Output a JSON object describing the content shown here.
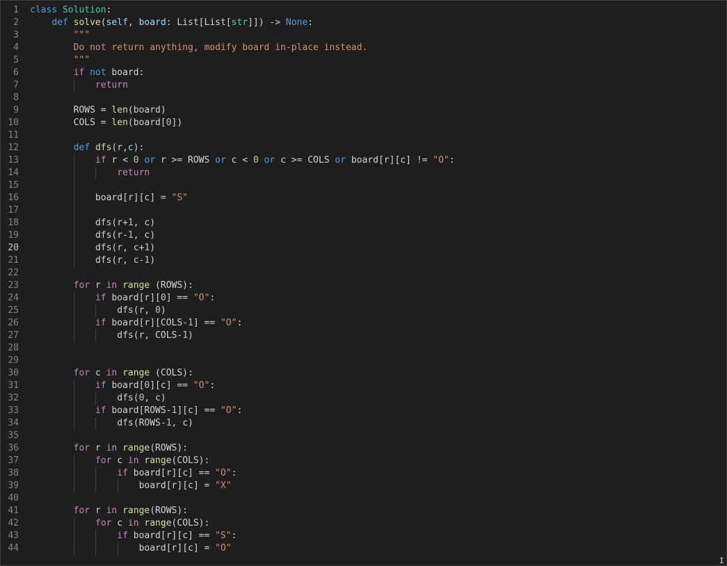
{
  "editor": {
    "cursor_glyph": "I",
    "active_line": 20,
    "lines": [
      {
        "n": "1",
        "indent": 0,
        "t": [
          [
            "kw",
            "class "
          ],
          [
            "cls",
            "Solution"
          ],
          [
            "plain",
            ":"
          ]
        ]
      },
      {
        "n": "2",
        "indent": 1,
        "t": [
          [
            "kw",
            "def "
          ],
          [
            "fn",
            "solve"
          ],
          [
            "plain",
            "("
          ],
          [
            "param",
            "self"
          ],
          [
            "plain",
            ", "
          ],
          [
            "param",
            "board"
          ],
          [
            "plain",
            ": List[List["
          ],
          [
            "cls",
            "str"
          ],
          [
            "plain",
            "]]) -> "
          ],
          [
            "kw",
            "None"
          ],
          [
            "plain",
            ":"
          ]
        ]
      },
      {
        "n": "3",
        "indent": 2,
        "t": [
          [
            "str",
            "\"\"\""
          ]
        ]
      },
      {
        "n": "4",
        "indent": 2,
        "t": [
          [
            "str",
            "Do not return anything, modify board in-place instead."
          ]
        ]
      },
      {
        "n": "5",
        "indent": 2,
        "t": [
          [
            "str",
            "\"\"\""
          ]
        ]
      },
      {
        "n": "6",
        "indent": 2,
        "t": [
          [
            "ctrl",
            "if "
          ],
          [
            "kw",
            "not "
          ],
          [
            "plain",
            "board:"
          ]
        ]
      },
      {
        "n": "7",
        "indent": 3,
        "t": [
          [
            "ctrl",
            "return"
          ]
        ]
      },
      {
        "n": "8",
        "indent": 2,
        "t": []
      },
      {
        "n": "9",
        "indent": 2,
        "t": [
          [
            "plain",
            "ROWS = "
          ],
          [
            "fn",
            "len"
          ],
          [
            "plain",
            "(board)"
          ]
        ]
      },
      {
        "n": "10",
        "indent": 2,
        "t": [
          [
            "plain",
            "COLS = "
          ],
          [
            "fn",
            "len"
          ],
          [
            "plain",
            "(board["
          ],
          [
            "num",
            "0"
          ],
          [
            "plain",
            "])"
          ]
        ]
      },
      {
        "n": "11",
        "indent": 2,
        "t": []
      },
      {
        "n": "12",
        "indent": 2,
        "t": [
          [
            "kw",
            "def "
          ],
          [
            "fn",
            "dfs"
          ],
          [
            "plain",
            "("
          ],
          [
            "param",
            "r"
          ],
          [
            "plain",
            ","
          ],
          [
            "param",
            "c"
          ],
          [
            "plain",
            "):"
          ]
        ]
      },
      {
        "n": "13",
        "indent": 3,
        "t": [
          [
            "ctrl",
            "if "
          ],
          [
            "plain",
            "r < "
          ],
          [
            "num",
            "0"
          ],
          [
            "plain",
            " "
          ],
          [
            "kw",
            "or"
          ],
          [
            "plain",
            " r >= ROWS "
          ],
          [
            "kw",
            "or"
          ],
          [
            "plain",
            " c < "
          ],
          [
            "num",
            "0"
          ],
          [
            "plain",
            " "
          ],
          [
            "kw",
            "or"
          ],
          [
            "plain",
            " c >= COLS "
          ],
          [
            "kw",
            "or"
          ],
          [
            "plain",
            " board[r][c] != "
          ],
          [
            "str",
            "\"O\""
          ],
          [
            "plain",
            ":"
          ]
        ]
      },
      {
        "n": "14",
        "indent": 4,
        "t": [
          [
            "ctrl",
            "return"
          ]
        ]
      },
      {
        "n": "15",
        "indent": 3,
        "t": []
      },
      {
        "n": "16",
        "indent": 3,
        "t": [
          [
            "plain",
            "board[r][c] = "
          ],
          [
            "str",
            "\"S\""
          ]
        ]
      },
      {
        "n": "17",
        "indent": 3,
        "t": []
      },
      {
        "n": "18",
        "indent": 3,
        "t": [
          [
            "plain",
            "dfs(r+"
          ],
          [
            "num",
            "1"
          ],
          [
            "plain",
            ", c)"
          ]
        ]
      },
      {
        "n": "19",
        "indent": 3,
        "t": [
          [
            "plain",
            "dfs(r-"
          ],
          [
            "num",
            "1"
          ],
          [
            "plain",
            ", c)"
          ]
        ]
      },
      {
        "n": "20",
        "indent": 3,
        "t": [
          [
            "plain",
            "dfs(r, c+"
          ],
          [
            "num",
            "1"
          ],
          [
            "plain",
            ")"
          ]
        ]
      },
      {
        "n": "21",
        "indent": 3,
        "t": [
          [
            "plain",
            "dfs(r, c-"
          ],
          [
            "num",
            "1"
          ],
          [
            "plain",
            ")"
          ]
        ]
      },
      {
        "n": "22",
        "indent": 2,
        "t": []
      },
      {
        "n": "23",
        "indent": 2,
        "t": [
          [
            "ctrl",
            "for "
          ],
          [
            "plain",
            "r "
          ],
          [
            "ctrl",
            "in "
          ],
          [
            "fn",
            "range"
          ],
          [
            "plain",
            " (ROWS):"
          ]
        ]
      },
      {
        "n": "24",
        "indent": 3,
        "t": [
          [
            "ctrl",
            "if "
          ],
          [
            "plain",
            "board[r]["
          ],
          [
            "num",
            "0"
          ],
          [
            "plain",
            "] == "
          ],
          [
            "str",
            "\"O\""
          ],
          [
            "plain",
            ":"
          ]
        ]
      },
      {
        "n": "25",
        "indent": 4,
        "t": [
          [
            "plain",
            "dfs(r, "
          ],
          [
            "num",
            "0"
          ],
          [
            "plain",
            ")"
          ]
        ]
      },
      {
        "n": "26",
        "indent": 3,
        "t": [
          [
            "ctrl",
            "if "
          ],
          [
            "plain",
            "board[r][COLS-"
          ],
          [
            "num",
            "1"
          ],
          [
            "plain",
            "] == "
          ],
          [
            "str",
            "\"O\""
          ],
          [
            "plain",
            ":"
          ]
        ]
      },
      {
        "n": "27",
        "indent": 4,
        "t": [
          [
            "plain",
            "dfs(r, COLS-"
          ],
          [
            "num",
            "1"
          ],
          [
            "plain",
            ")"
          ]
        ]
      },
      {
        "n": "28",
        "indent": 2,
        "t": []
      },
      {
        "n": "29",
        "indent": 2,
        "t": []
      },
      {
        "n": "30",
        "indent": 2,
        "t": [
          [
            "ctrl",
            "for "
          ],
          [
            "plain",
            "c "
          ],
          [
            "ctrl",
            "in "
          ],
          [
            "fn",
            "range"
          ],
          [
            "plain",
            " (COLS):"
          ]
        ]
      },
      {
        "n": "31",
        "indent": 3,
        "t": [
          [
            "ctrl",
            "if "
          ],
          [
            "plain",
            "board["
          ],
          [
            "num",
            "0"
          ],
          [
            "plain",
            "][c] == "
          ],
          [
            "str",
            "\"O\""
          ],
          [
            "plain",
            ":"
          ]
        ]
      },
      {
        "n": "32",
        "indent": 4,
        "t": [
          [
            "plain",
            "dfs("
          ],
          [
            "num",
            "0"
          ],
          [
            "plain",
            ", c)"
          ]
        ]
      },
      {
        "n": "33",
        "indent": 3,
        "t": [
          [
            "ctrl",
            "if "
          ],
          [
            "plain",
            "board[ROWS-"
          ],
          [
            "num",
            "1"
          ],
          [
            "plain",
            "][c] == "
          ],
          [
            "str",
            "\"O\""
          ],
          [
            "plain",
            ":"
          ]
        ]
      },
      {
        "n": "34",
        "indent": 4,
        "t": [
          [
            "plain",
            "dfs(ROWS-"
          ],
          [
            "num",
            "1"
          ],
          [
            "plain",
            ", c)"
          ]
        ]
      },
      {
        "n": "35",
        "indent": 2,
        "t": []
      },
      {
        "n": "36",
        "indent": 2,
        "t": [
          [
            "ctrl",
            "for "
          ],
          [
            "plain",
            "r "
          ],
          [
            "ctrl",
            "in "
          ],
          [
            "fn",
            "range"
          ],
          [
            "plain",
            "(ROWS):"
          ]
        ]
      },
      {
        "n": "37",
        "indent": 3,
        "t": [
          [
            "ctrl",
            "for "
          ],
          [
            "plain",
            "c "
          ],
          [
            "ctrl",
            "in "
          ],
          [
            "fn",
            "range"
          ],
          [
            "plain",
            "(COLS):"
          ]
        ]
      },
      {
        "n": "38",
        "indent": 4,
        "t": [
          [
            "ctrl",
            "if "
          ],
          [
            "plain",
            "board[r][c] == "
          ],
          [
            "str",
            "\"O\""
          ],
          [
            "plain",
            ":"
          ]
        ]
      },
      {
        "n": "39",
        "indent": 5,
        "t": [
          [
            "plain",
            "board[r][c] = "
          ],
          [
            "str",
            "\"X\""
          ]
        ]
      },
      {
        "n": "40",
        "indent": 2,
        "t": []
      },
      {
        "n": "41",
        "indent": 2,
        "t": [
          [
            "ctrl",
            "for "
          ],
          [
            "plain",
            "r "
          ],
          [
            "ctrl",
            "in "
          ],
          [
            "fn",
            "range"
          ],
          [
            "plain",
            "(ROWS):"
          ]
        ]
      },
      {
        "n": "42",
        "indent": 3,
        "t": [
          [
            "ctrl",
            "for "
          ],
          [
            "plain",
            "c "
          ],
          [
            "ctrl",
            "in "
          ],
          [
            "fn",
            "range"
          ],
          [
            "plain",
            "(COLS):"
          ]
        ]
      },
      {
        "n": "43",
        "indent": 4,
        "t": [
          [
            "ctrl",
            "if "
          ],
          [
            "plain",
            "board[r][c] == "
          ],
          [
            "str",
            "\"S\""
          ],
          [
            "plain",
            ":"
          ]
        ]
      },
      {
        "n": "44",
        "indent": 5,
        "t": [
          [
            "plain",
            "board[r][c] = "
          ],
          [
            "str",
            "\"O\""
          ]
        ]
      }
    ]
  }
}
